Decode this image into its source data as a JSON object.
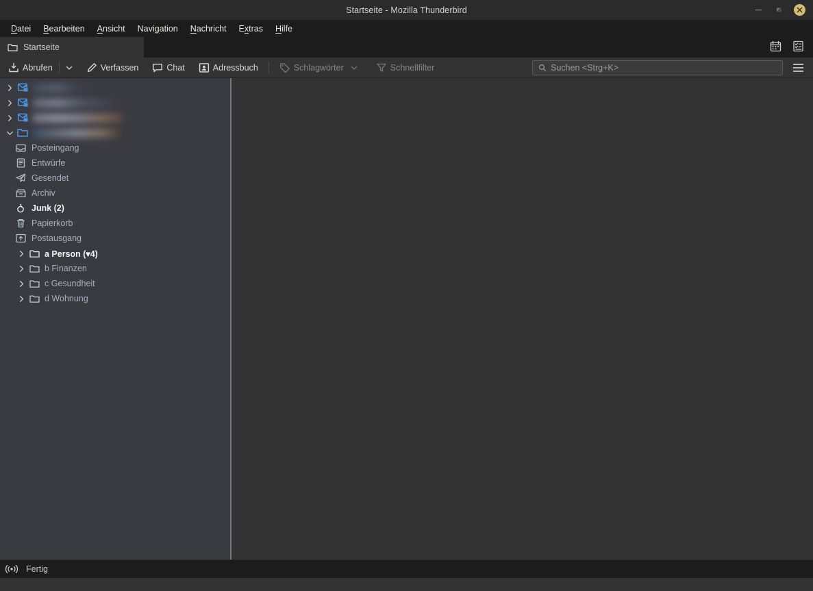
{
  "window": {
    "title": "Startseite - Mozilla Thunderbird",
    "controls": {
      "minimize": "minimize-button",
      "maximize": "maximize-button",
      "close": "close-button"
    },
    "close_color": "#d3bd72"
  },
  "menubar": {
    "items": [
      {
        "label": "Datei",
        "accesskey_index": 0
      },
      {
        "label": "Bearbeiten",
        "accesskey_index": 0
      },
      {
        "label": "Ansicht",
        "accesskey_index": 0
      },
      {
        "label": "Navigation",
        "accesskey_index": 3
      },
      {
        "label": "Nachricht",
        "accesskey_index": 0
      },
      {
        "label": "Extras",
        "accesskey_index": 1
      },
      {
        "label": "Hilfe",
        "accesskey_index": 0
      }
    ]
  },
  "tabbar": {
    "tabs": [
      {
        "label": "Startseite",
        "icon": "folder-icon",
        "active": true
      }
    ],
    "right_icons": [
      {
        "name": "calendar-icon"
      },
      {
        "name": "tasks-icon"
      }
    ]
  },
  "toolbar": {
    "get_messages_label": "Abrufen",
    "get_messages_dropdown": "chevron-down-icon",
    "compose_label": "Verfassen",
    "chat_label": "Chat",
    "addressbook_label": "Adressbuch",
    "tags_label": "Schlagwörter",
    "tags_dropdown": "chevron-down-icon",
    "quickfilter_label": "Schnellfilter",
    "menu_button": "hamburger-icon"
  },
  "search": {
    "placeholder": "Suchen <Strg+K>",
    "value": "",
    "icon": "search-icon"
  },
  "folder_pane": {
    "accounts": [
      {
        "icon": "mail-lock-icon",
        "twisty": "chevron-right-icon",
        "name_redacted": true,
        "blur_class": "bn1"
      },
      {
        "icon": "mail-lock-icon",
        "twisty": "chevron-right-icon",
        "name_redacted": true,
        "blur_class": "bn2"
      },
      {
        "icon": "mail-lock-icon",
        "twisty": "chevron-right-icon",
        "name_redacted": true,
        "blur_class": "bn3"
      },
      {
        "icon": "folder-open-icon",
        "twisty": "chevron-down-icon",
        "name_redacted": true,
        "blur_class": "bn4",
        "expanded": true
      }
    ],
    "folders": [
      {
        "label": "Posteingang",
        "icon": "inbox-icon",
        "bold": false,
        "twisty": false
      },
      {
        "label": "Entwürfe",
        "icon": "drafts-icon",
        "bold": false,
        "twisty": false
      },
      {
        "label": "Gesendet",
        "icon": "sent-icon",
        "bold": false,
        "twisty": false
      },
      {
        "label": "Archiv",
        "icon": "archive-icon",
        "bold": false,
        "twisty": false
      },
      {
        "label": "Junk (2)",
        "icon": "junk-icon",
        "bold": true,
        "twisty": false
      },
      {
        "label": "Papierkorb",
        "icon": "trash-icon",
        "bold": false,
        "twisty": false
      },
      {
        "label": "Postausgang",
        "icon": "outbox-icon",
        "bold": false,
        "twisty": false
      },
      {
        "label": "a Person (▾4)",
        "icon": "folder-icon",
        "bold": true,
        "twisty": true
      },
      {
        "label": "b Finanzen",
        "icon": "folder-icon",
        "bold": false,
        "twisty": true
      },
      {
        "label": "c Gesundheit",
        "icon": "folder-icon",
        "bold": false,
        "twisty": true
      },
      {
        "label": "d Wohnung",
        "icon": "folder-icon",
        "bold": false,
        "twisty": true
      }
    ]
  },
  "statusbar": {
    "icon": "network-activity-icon",
    "text": "Fertig"
  },
  "colors": {
    "titlebar_bg": "#2b2b2b",
    "menubar_bg": "#1c1c1c",
    "toolbar_bg": "#333333",
    "folder_pane_bg": "#3a3a41",
    "content_bg": "#333333",
    "accent_blue": "#4d94e0",
    "text_primary": "#d7d7d7",
    "text_muted": "#a9b0bd"
  }
}
